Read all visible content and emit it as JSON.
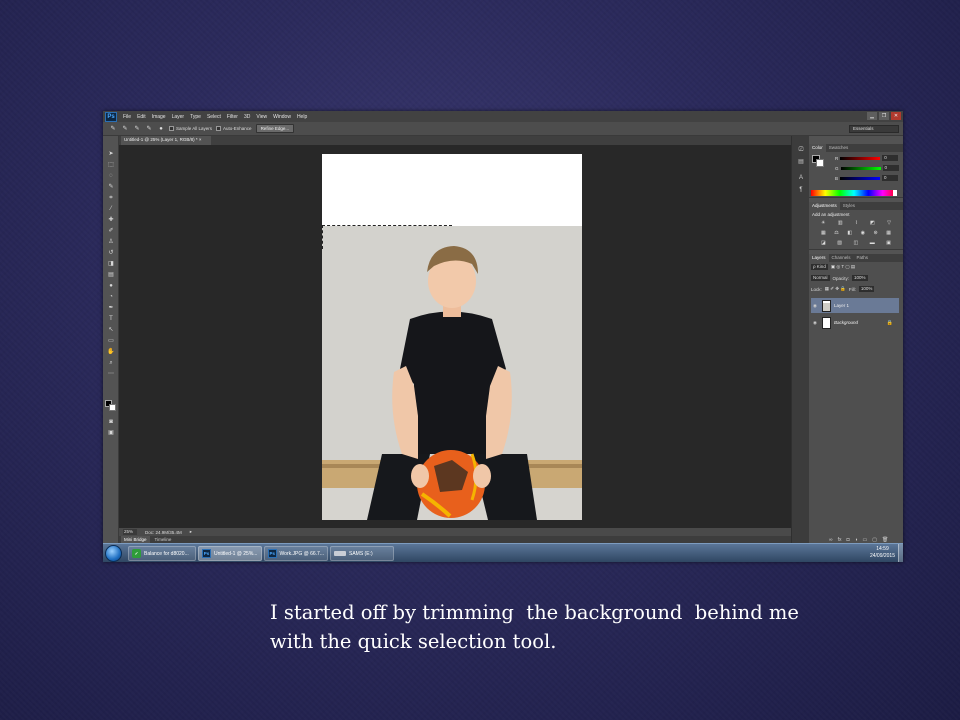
{
  "photoshop": {
    "logo": "Ps",
    "menu": [
      "File",
      "Edit",
      "Image",
      "Layer",
      "Type",
      "Select",
      "Filter",
      "3D",
      "View",
      "Window",
      "Help"
    ],
    "window_controls": [
      "▁",
      "❐",
      "✕"
    ],
    "options_bar": {
      "sample_all_layers": "Sample All Layers",
      "auto_enhance": "Auto-Enhance",
      "refine_edge": "Refine Edge...",
      "workspace": "Essentials"
    },
    "document_tab": "Untitled-1 @ 25% (Layer 1, RGB/8) * ×",
    "status": {
      "zoom": "25%",
      "doc_size": "Doc: 24.9M/35.4M"
    },
    "bottom_tabs": [
      "Mini Bridge",
      "Timeline"
    ],
    "panels": {
      "color": {
        "tabs": [
          "Color",
          "Swatches"
        ],
        "channels": [
          {
            "label": "R",
            "value": "0"
          },
          {
            "label": "G",
            "value": "0"
          },
          {
            "label": "B",
            "value": "0"
          }
        ]
      },
      "adjustments": {
        "tabs": [
          "Adjustments",
          "Styles"
        ],
        "title": "Add an adjustment"
      },
      "layers": {
        "tabs": [
          "Layers",
          "Channels",
          "Paths"
        ],
        "kind_filter": "ρ Kind",
        "blend_mode": "Normal",
        "opacity_label": "Opacity:",
        "opacity_value": "100%",
        "lock_label": "Lock:",
        "fill_label": "Fill:",
        "fill_value": "100%",
        "items": [
          {
            "name": "Layer 1",
            "selected": true
          },
          {
            "name": "Background",
            "selected": false
          }
        ]
      }
    }
  },
  "taskbar": {
    "items": [
      {
        "label": "Balance for d8020...",
        "icon": "green-app-icon"
      },
      {
        "label": "Untitled-1 @ 25%...",
        "icon": "Ps",
        "active": true
      },
      {
        "label": "Work.JPG @ 66.7...",
        "icon": "Ps"
      },
      {
        "label": "SAMS (E:)",
        "icon": "drive-icon"
      }
    ],
    "clock_time": "14:59",
    "clock_date": "24/09/2015"
  },
  "caption": {
    "line1": "I started off by trimming  the background  behind me",
    "line2": "with the quick selection tool."
  },
  "colors": {
    "slide_bg": "#2b2a5c",
    "ps_chrome": "#535353",
    "ps_canvas_bg": "#282828",
    "selected_layer": "#6a7a96",
    "ps_logo_blue": "#4aa8ff"
  }
}
